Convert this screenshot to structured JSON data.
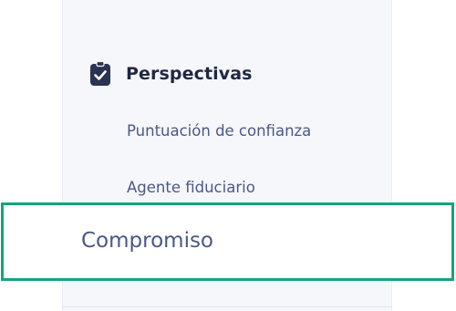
{
  "sidebar": {
    "section": {
      "title": "Perspectivas",
      "icon": "clipboard-check-icon",
      "icon_color": "#2b3352"
    },
    "items": [
      {
        "label": "Puntuación de confianza"
      },
      {
        "label": "Agente fiduciario"
      }
    ],
    "highlighted_item": {
      "label": "Compromiso",
      "highlight_color": "#16a37f"
    }
  }
}
